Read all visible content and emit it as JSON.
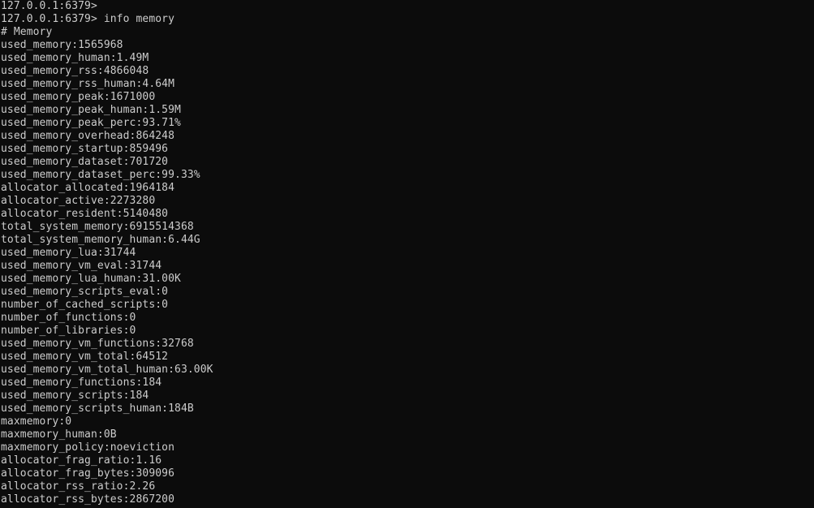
{
  "terminal": {
    "foreground_color": "#cccccc",
    "background_color": "#0c0c0c",
    "lines": [
      "127.0.0.1:6379>",
      "127.0.0.1:6379> info memory",
      "# Memory",
      "used_memory:1565968",
      "used_memory_human:1.49M",
      "used_memory_rss:4866048",
      "used_memory_rss_human:4.64M",
      "used_memory_peak:1671000",
      "used_memory_peak_human:1.59M",
      "used_memory_peak_perc:93.71%",
      "used_memory_overhead:864248",
      "used_memory_startup:859496",
      "used_memory_dataset:701720",
      "used_memory_dataset_perc:99.33%",
      "allocator_allocated:1964184",
      "allocator_active:2273280",
      "allocator_resident:5140480",
      "total_system_memory:6915514368",
      "total_system_memory_human:6.44G",
      "used_memory_lua:31744",
      "used_memory_vm_eval:31744",
      "used_memory_lua_human:31.00K",
      "used_memory_scripts_eval:0",
      "number_of_cached_scripts:0",
      "number_of_functions:0",
      "number_of_libraries:0",
      "used_memory_vm_functions:32768",
      "used_memory_vm_total:64512",
      "used_memory_vm_total_human:63.00K",
      "used_memory_functions:184",
      "used_memory_scripts:184",
      "used_memory_scripts_human:184B",
      "maxmemory:0",
      "maxmemory_human:0B",
      "maxmemory_policy:noeviction",
      "allocator_frag_ratio:1.16",
      "allocator_frag_bytes:309096",
      "allocator_rss_ratio:2.26",
      "allocator_rss_bytes:2867200"
    ]
  }
}
